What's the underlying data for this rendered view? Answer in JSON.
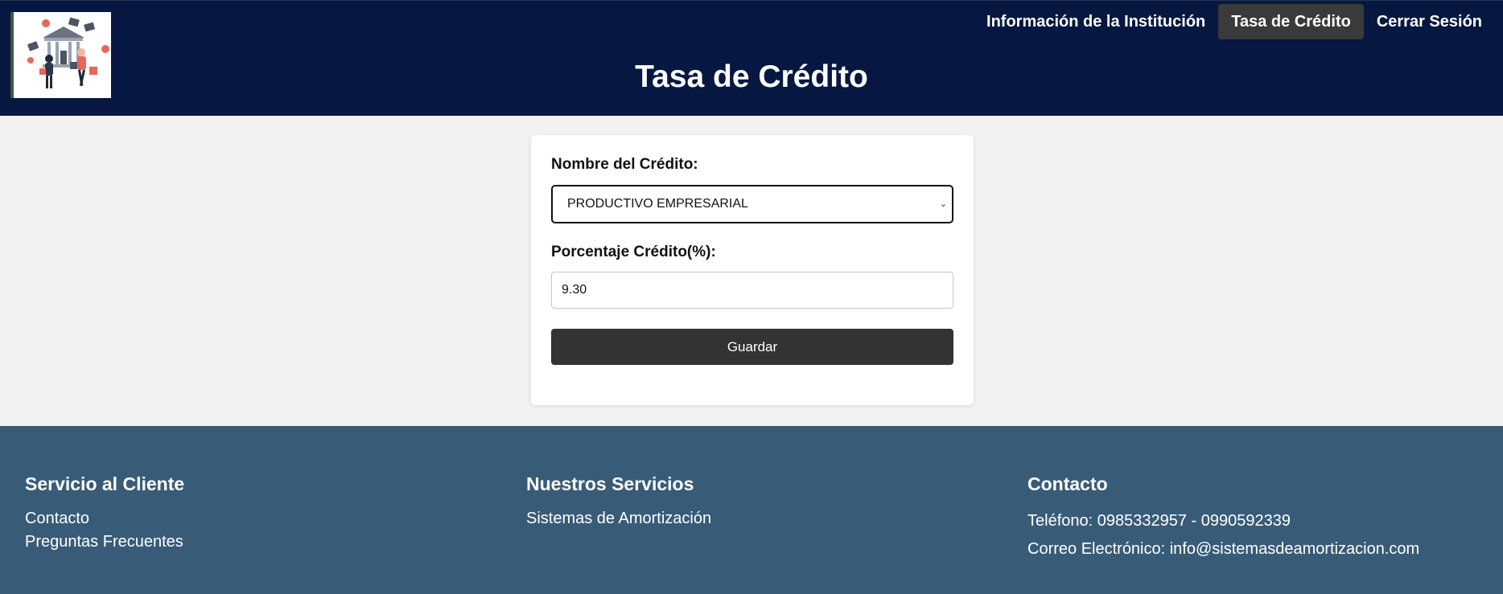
{
  "header": {
    "title": "Tasa de Crédito",
    "nav": [
      {
        "label": "Información de la Institución",
        "active": false
      },
      {
        "label": "Tasa de Crédito",
        "active": true
      },
      {
        "label": "Cerrar Sesión",
        "active": false
      }
    ],
    "background": "#061841"
  },
  "form": {
    "credit_name_label": "Nombre del Crédito:",
    "credit_name_value": "PRODUCTIVO EMPRESARIAL",
    "percentage_label": "Porcentaje Crédito(%):",
    "percentage_value": "9.30",
    "save_label": "Guardar"
  },
  "footer": {
    "background": "#385c78",
    "customer_service": {
      "title": "Servicio al Cliente",
      "links": [
        "Contacto",
        "Preguntas Frecuentes"
      ]
    },
    "services": {
      "title": "Nuestros Servicios",
      "links": [
        "Sistemas de Amortización"
      ]
    },
    "contact": {
      "title": "Contacto",
      "phone": "Teléfono: 0985332957 - 0990592339",
      "email": "Correo Electrónico: info@sistemasdeamortizacion.com"
    }
  }
}
